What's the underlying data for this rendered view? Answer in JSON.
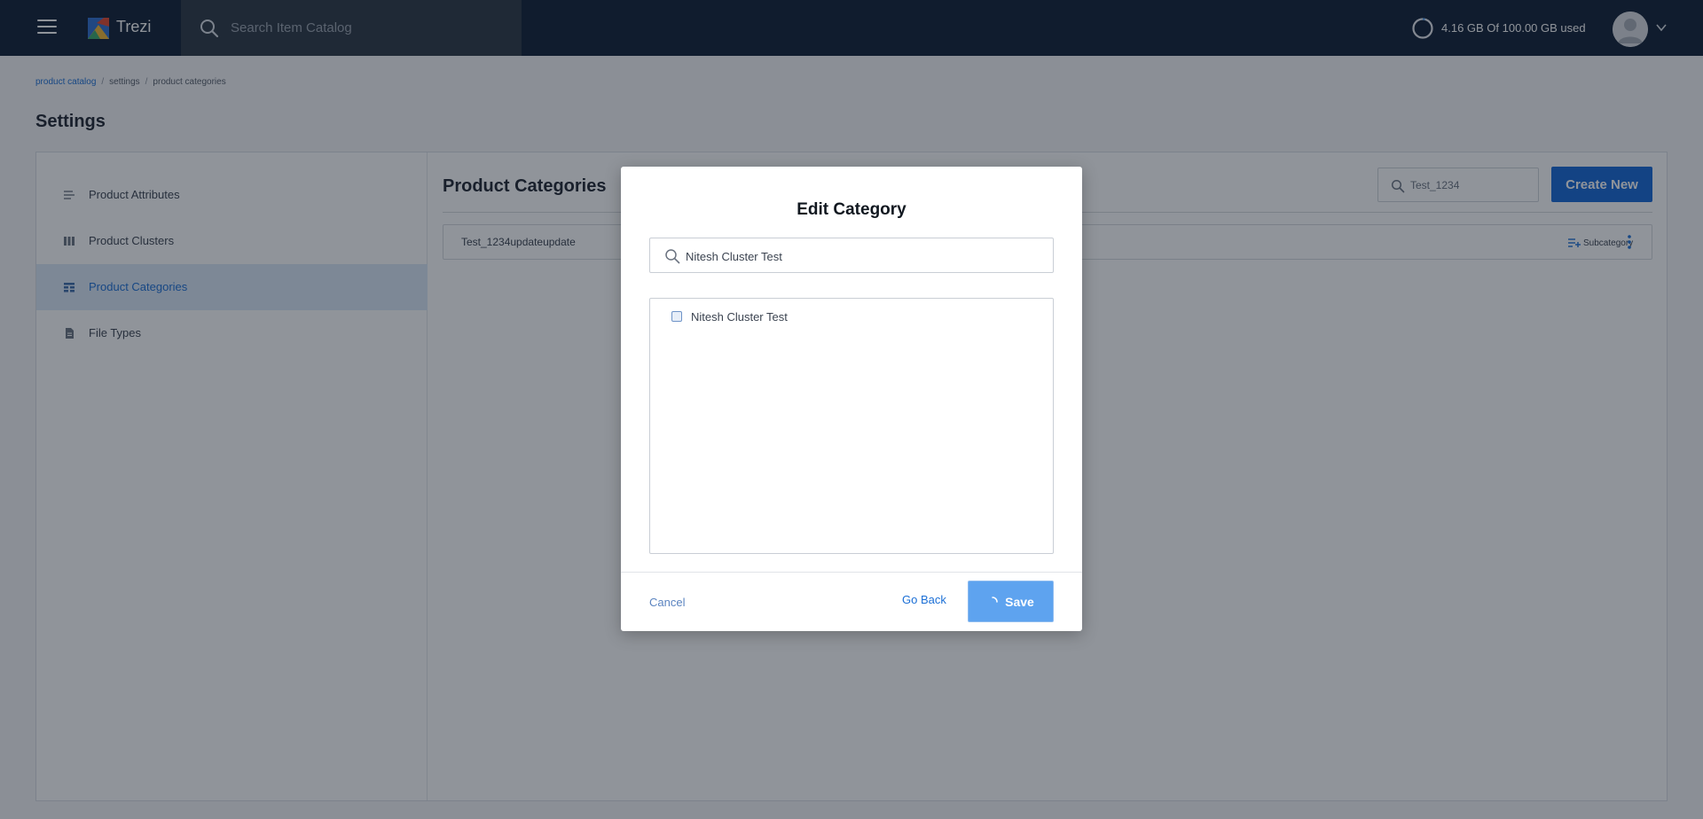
{
  "topbar": {
    "brand": "Trezi",
    "search_placeholder": "Search Item Catalog",
    "storage_text": "4.16 GB Of 100.00 GB used",
    "storage_fraction": 0.0416,
    "icons": {
      "menu": "hamburger-icon",
      "search": "search-icon",
      "storage": "progress-ring-icon",
      "avatar": "user-avatar-icon",
      "caret": "chevron-down-icon"
    }
  },
  "breadcrumb": {
    "items": [
      "product catalog",
      "settings",
      "product categories"
    ],
    "separator": "/"
  },
  "page": {
    "title": "Settings"
  },
  "sidebar": {
    "items": [
      {
        "label": "Product Attributes",
        "icon": "list-lines-icon",
        "active": false
      },
      {
        "label": "Product Clusters",
        "icon": "columns-icon",
        "active": false
      },
      {
        "label": "Product Categories",
        "icon": "table-icon",
        "active": true
      },
      {
        "label": "File Types",
        "icon": "file-icon",
        "active": false
      }
    ]
  },
  "content": {
    "title": "Product Categories",
    "search_value": "Test_1234",
    "create_label": "Create New",
    "rows": [
      {
        "name": "Test_1234updateupdate",
        "subcategory_label": "Subcategory"
      }
    ]
  },
  "modal": {
    "title": "Edit Category",
    "search_value": "Nitesh Cluster Test",
    "list": [
      {
        "label": "Nitesh Cluster Test",
        "checked": false
      }
    ],
    "cancel_label": "Cancel",
    "goback_label": "Go Back",
    "save_label": "Save"
  },
  "colors": {
    "topbar": "#0f1e33",
    "accent": "#1366d6",
    "active_nav_bg": "#dce8f7",
    "save_loading": "#5ea3ef"
  }
}
